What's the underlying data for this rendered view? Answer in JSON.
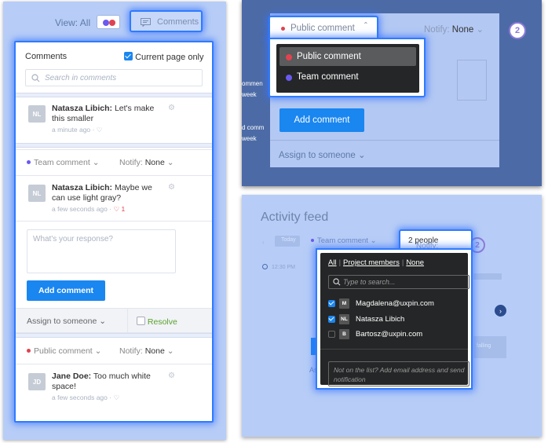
{
  "panel1": {
    "view_label": "View: All",
    "comments_button": "Comments",
    "card": {
      "title": "Comments",
      "current_page_label": "Current page only",
      "search_placeholder": "Search in comments"
    },
    "comment1": {
      "avatar": "NL",
      "author": "Natasza Libich:",
      "text_line1": "Let's make",
      "text_line2": "this smaller",
      "time": "a minute ago"
    },
    "thread2": {
      "type": "Team comment",
      "notify_label": "Notify:",
      "notify_value": "None",
      "avatar": "NL",
      "author": "Natasza Libich:",
      "text_line1": "Maybe we",
      "text_line2": "can use light gray?",
      "time": "a few seconds ago",
      "likes": "1",
      "response_placeholder": "What's your response?",
      "add_comment": "Add comment",
      "assign": "Assign to someone",
      "resolve": "Resolve"
    },
    "thread3": {
      "type": "Public comment",
      "notify_label": "Notify:",
      "notify_value": "None",
      "avatar": "JD",
      "author": "Jane Doe:",
      "text_line1": "Too much white",
      "text_line2": "space!",
      "time": "a few seconds ago"
    }
  },
  "panel2": {
    "selected_type": "Public comment",
    "notify_label": "Notify:",
    "notify_value": "None",
    "step": "2",
    "options": [
      "Public comment",
      "Team comment"
    ],
    "add_comment": "Add comment",
    "assign": "Assign to someone",
    "side_text": [
      "ommen",
      "week",
      "d comm",
      "week"
    ]
  },
  "panel3": {
    "title": "Activity feed",
    "type": "Team comment",
    "today": "Today",
    "time": "12:30 PM",
    "notify_label": "Notify:",
    "notify_value": "2 people",
    "step": "2",
    "tabs": [
      "All",
      "Project members",
      "None"
    ],
    "search_placeholder": "Type to search...",
    "people": [
      {
        "initial": "M",
        "name": "Magdalena@uxpin.com",
        "checked": true
      },
      {
        "initial": "NL",
        "name": "Natasza Libich",
        "checked": true
      },
      {
        "initial": "B",
        "name": "Bartosz@uxpin.com",
        "checked": false
      }
    ],
    "note": "Not on the list? Add email address and send notification",
    "faint_side": "falling",
    "faint_as": "As"
  },
  "colors": {
    "accent": "#1a86f0",
    "public_dot": "#e0434f",
    "team_dot": "#6a5af0",
    "highlight": "#2f7bff"
  }
}
